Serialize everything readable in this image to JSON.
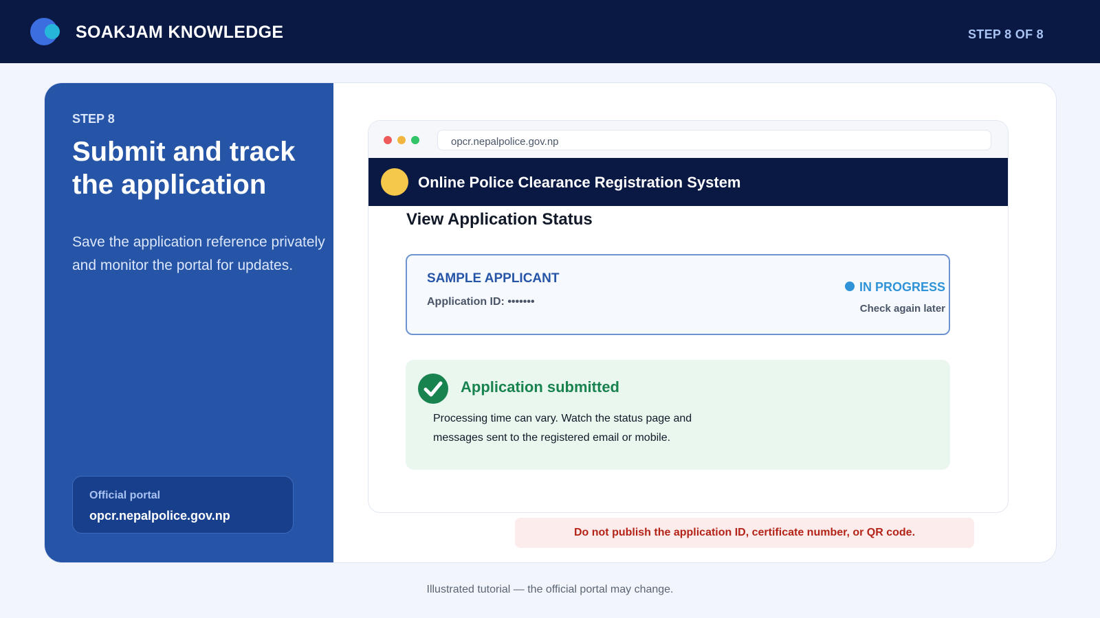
{
  "header": {
    "brand": "SOAKJAM KNOWLEDGE",
    "step_counter": "STEP 8 OF 8"
  },
  "sidebar": {
    "step_label": "STEP 8",
    "title": "Submit and track the application",
    "description": "Save the application reference privately and monitor the portal for updates.",
    "portal_label": "Official portal",
    "portal_url": "opcr.nepalpolice.gov.np"
  },
  "browser": {
    "url": "opcr.nepalpolice.gov.np",
    "site_title": "Online Police Clearance Registration System",
    "page_heading": "View Application Status",
    "status_card": {
      "applicant": "SAMPLE APPLICANT",
      "application_id": "Application ID: •••••••",
      "status": "IN PROGRESS",
      "status_note": "Check again later"
    },
    "success": {
      "title": "Application submitted",
      "body": "Processing time can vary. Watch the status page and messages sent to the registered email or mobile."
    }
  },
  "warning": "Do not publish the application ID, certificate number, or QR code.",
  "footer": "Illustrated tutorial — the official portal may change.",
  "colors": {
    "navy": "#0a1844",
    "brand_blue": "#2654a6",
    "status_blue": "#2f93d8",
    "success_green": "#18834f",
    "warning_red": "#b42318",
    "emblem_yellow": "#f5c84b"
  },
  "icons": [
    "logo-icon",
    "window-close-dot",
    "window-minimize-dot",
    "window-maximize-dot",
    "emblem-icon",
    "status-dot-icon",
    "checkmark-icon"
  ]
}
